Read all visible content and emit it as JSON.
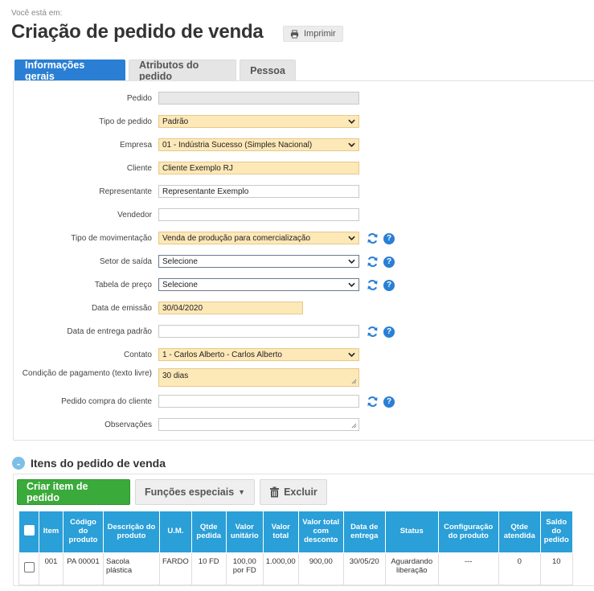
{
  "breadcrumb": "Você está em:",
  "page": {
    "title": "Criação de pedido de venda",
    "print_label": "Imprimir"
  },
  "tabs": [
    {
      "label": "Informações gerais",
      "active": true
    },
    {
      "label": "Atributos do pedido",
      "active": false
    },
    {
      "label": "Pessoa",
      "active": false
    }
  ],
  "form": {
    "pedido": {
      "label": "Pedido",
      "value": ""
    },
    "tipo_pedido": {
      "label": "Tipo de pedido",
      "value": "Padrão"
    },
    "empresa": {
      "label": "Empresa",
      "value": "01 - Indústria Sucesso (Simples Nacional)"
    },
    "cliente": {
      "label": "Cliente",
      "value": "Cliente Exemplo RJ"
    },
    "representante": {
      "label": "Representante",
      "value": "Representante Exemplo"
    },
    "vendedor": {
      "label": "Vendedor",
      "value": ""
    },
    "tipo_movimentacao": {
      "label": "Tipo de movimentação",
      "value": "Venda de produção para comercialização"
    },
    "setor_saida": {
      "label": "Setor de saída",
      "value": "Selecione"
    },
    "tabela_preco": {
      "label": "Tabela de preço",
      "value": "Selecione"
    },
    "data_emissao": {
      "label": "Data de emissão",
      "value": "30/04/2020"
    },
    "data_entrega": {
      "label": "Data de entrega padrão",
      "value": ""
    },
    "contato": {
      "label": "Contato",
      "value": "1 - Carlos Alberto - Carlos Alberto"
    },
    "condicao_pagamento": {
      "label": "Condição de pagamento (texto livre)",
      "value": "30 dias"
    },
    "pedido_compra": {
      "label": "Pedido compra do cliente",
      "value": ""
    },
    "observacoes": {
      "label": "Observações",
      "value": ""
    }
  },
  "items_section": {
    "title": "Itens do pedido de venda",
    "collapse_symbol": "-",
    "create_label": "Criar item de pedido",
    "special_label": "Funções especiais",
    "delete_label": "Excluir",
    "columns": [
      "Item",
      "Código do produto",
      "Descrição do produto",
      "U.M.",
      "Qtde pedida",
      "Valor unitário",
      "Valor total",
      "Valor total com desconto",
      "Data de entrega",
      "Status",
      "Configuração do produto",
      "Qtde atendida",
      "Saldo do pedido"
    ],
    "rows": [
      [
        "001",
        "PA 00001",
        "Sacola plástica",
        "FARDO",
        "10 FD",
        "100,00 por FD",
        "1.000,00",
        "900,00",
        "30/05/20",
        "Aguardando liberação",
        "---",
        "0",
        "10"
      ]
    ]
  },
  "colors": {
    "accent": "#2a7fd4",
    "table_header": "#2a9fd8",
    "required_field": "#fde8b8",
    "primary_button": "#3aaa3a"
  },
  "icons": {
    "print": "printer-icon",
    "refresh": "refresh-icon",
    "help": "help-icon",
    "delete": "trash-icon"
  }
}
